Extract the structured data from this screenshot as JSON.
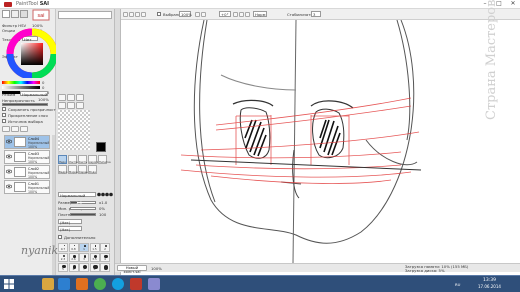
{
  "window": {
    "app_name": "PaintTool",
    "app_brand": "SAI",
    "minimize": "–",
    "maximize": "□",
    "close": "✕"
  },
  "left_panel": {
    "color_labels": [
      "Фильтр HSV",
      "100%",
      "Опции",
      "100%"
    ],
    "color_readouts": [
      "0",
      "0",
      "100",
      "100",
      "100"
    ],
    "modes_labels": [
      "Текстура",
      "Нет",
      "Эффект",
      "Нет"
    ],
    "layer_header": [
      "Режим",
      "Нормальный"
    ],
    "opacity_label": "Непрозрачность",
    "opacity_value": "100%",
    "checks": [
      "Сохранять прозрачность",
      "Прикрепление слоя",
      "Источник выбора"
    ],
    "layers": [
      {
        "name": "Слой4",
        "mode": "Нормальный",
        "pct": "100%"
      },
      {
        "name": "Слой3",
        "mode": "Нормальный",
        "pct": "100%"
      },
      {
        "name": "Слой2",
        "mode": "Нормальный",
        "pct": "100%"
      },
      {
        "name": "Слой1",
        "mode": "Нормальный",
        "pct": "100%"
      }
    ]
  },
  "tool_panel": {
    "tools": [
      "Перо",
      "Ластик",
      "Кисть",
      "Аэрограф",
      "Пипетка",
      "Ведро",
      "Маркер",
      "Карандаш",
      "Вода"
    ],
    "blend_label": "Нормальный",
    "size_label": "Размер",
    "size_value": "1.0",
    "size_scale": "x1.0",
    "min_size_label": "Мин. размер",
    "min_size_value": "0%",
    "density_label": "Плотность",
    "density_value": "100",
    "shape_label": "(Нет)",
    "texture_label": "(Нет)",
    "adv_label": "Дополнительно",
    "brush_sizes": [
      "0.7",
      "0.8",
      "1",
      "1.5",
      "2",
      "2.3",
      "2.6",
      "3",
      "3.5",
      "4",
      "5",
      "6",
      "7",
      "8",
      "9"
    ]
  },
  "canvas_toolbar": {
    "zoom_value": "100%",
    "angle_value": "+0°",
    "filter_label": "Выбрано",
    "flip_label": "Норм",
    "stabilizer_label": "Стабилизатор",
    "stabilizer_value": "3"
  },
  "status": {
    "file_tab": "Новый холст.sai",
    "zoom_tab": "100%",
    "memory": "Загрузка памяти: 10% (155 МБ)",
    "drive": "Загрузка диска: 5%"
  },
  "taskbar": {
    "lang": "RU",
    "time": "13:39",
    "date": "17.06.2014",
    "apps": [
      "folder-icon",
      "browser-icon",
      "player-icon",
      "chrome-icon",
      "skype-icon",
      "media-icon",
      "sai-icon"
    ]
  },
  "canvas": {
    "signature": "nyanik",
    "watermark": "Страна Мастеров"
  }
}
